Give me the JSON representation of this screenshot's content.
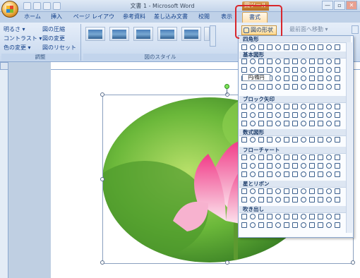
{
  "window": {
    "title": "文書 1 - Microsoft Word",
    "context_tab_title": "図ツール",
    "controls": [
      "—",
      "▫",
      "✕"
    ]
  },
  "tabs": [
    {
      "label": "ホーム"
    },
    {
      "label": "挿入"
    },
    {
      "label": "ページ レイアウト"
    },
    {
      "label": "参考資料"
    },
    {
      "label": "差し込み文書"
    },
    {
      "label": "校閲"
    },
    {
      "label": "表示"
    },
    {
      "label": "書式",
      "selected": true
    }
  ],
  "ribbon": {
    "adjust": {
      "items": [
        "明るさ ▾",
        "コントラスト ▾",
        "色の変更 ▾",
        "図の圧縮",
        "図の変更",
        "図のリセット"
      ],
      "label": "調整"
    },
    "picture_styles": {
      "label": "図のスタイル",
      "thumbnail_count": 6
    },
    "shape_button_label": "図の形状",
    "bring_forward_label": "最前面へ移動 ▾"
  },
  "dropdown": {
    "sections": [
      "四角形",
      "基本図形",
      "ブロック矢印",
      "数式図形",
      "フローチャート",
      "星とリボン",
      "吹き出し"
    ],
    "tooltip": "円/楕円"
  },
  "accent_colors": {
    "callout": "#d8262c",
    "selected_tab": "#ffe1b0",
    "ribbon": "#c7d8ee"
  }
}
